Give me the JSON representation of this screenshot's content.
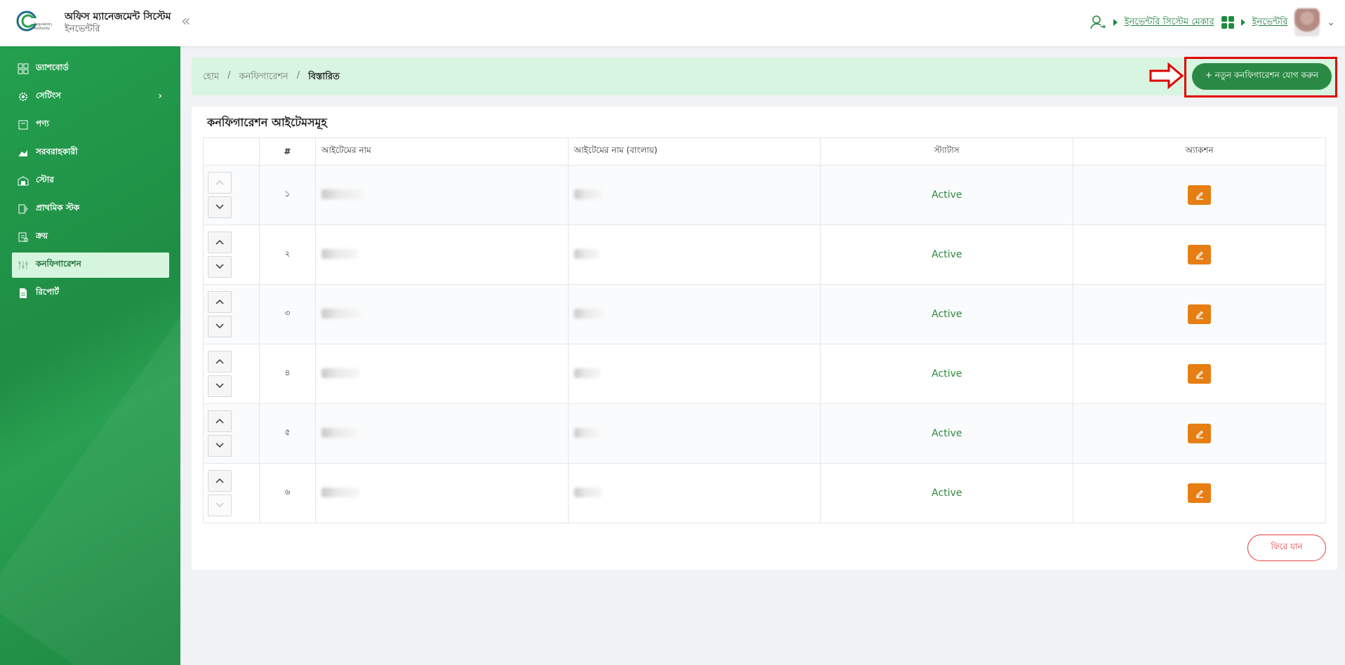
{
  "header": {
    "app_title": "অফিস ম্যানেজমেন্ট সিস্টেম",
    "app_subtitle": "ইনভেন্টরি",
    "collapse_label": "«",
    "role_link": "ইনভেন্টরি সিস্টেম মেকার",
    "module_link": "ইনভেন্টরি",
    "icons": {
      "user": "user-switch-icon",
      "apps": "grid-apps-icon",
      "chevron": "chevron-down-icon"
    }
  },
  "sidebar": {
    "items": [
      {
        "label": "ড্যাশবোর্ড",
        "icon": "dashboard-icon"
      },
      {
        "label": "সেটিংস",
        "icon": "gear-icon",
        "has_submenu": true
      },
      {
        "label": "পণ্য",
        "icon": "product-icon"
      },
      {
        "label": "সরবরাহকারী",
        "icon": "supplier-icon"
      },
      {
        "label": "স্টোর",
        "icon": "store-icon"
      },
      {
        "label": "প্রাথমিক স্টক",
        "icon": "stock-icon"
      },
      {
        "label": "ক্রয়",
        "icon": "purchase-icon"
      },
      {
        "label": "কনফিগারেশন",
        "icon": "configuration-icon",
        "active": true
      },
      {
        "label": "রিপোর্ট",
        "icon": "report-icon"
      }
    ]
  },
  "breadcrumb": {
    "items": [
      "হোম",
      "কনফিগারেশন",
      "বিস্তারিত"
    ],
    "separator": "/"
  },
  "actions": {
    "add_button": "+ নতুন কনফিগারেশন যোগ করুন",
    "back_button": "ফিরে যান"
  },
  "table": {
    "title": "কনফিগারেশন আইটেমসমূহ",
    "headers": [
      "",
      "#",
      "আইটেমের নাম",
      "আইটেমের নাম (বাংলায়)",
      "স্ট্যাটাস",
      "অ্যাকশন"
    ],
    "rows": [
      {
        "index": "১",
        "status": "Active",
        "up_disabled": true,
        "down_disabled": false
      },
      {
        "index": "২",
        "status": "Active",
        "up_disabled": false,
        "down_disabled": false
      },
      {
        "index": "৩",
        "status": "Active",
        "up_disabled": false,
        "down_disabled": false
      },
      {
        "index": "৪",
        "status": "Active",
        "up_disabled": false,
        "down_disabled": false
      },
      {
        "index": "৫",
        "status": "Active",
        "up_disabled": false,
        "down_disabled": false
      },
      {
        "index": "৬",
        "status": "Active",
        "up_disabled": false,
        "down_disabled": true
      }
    ]
  },
  "colors": {
    "primary_green": "#2a8a45",
    "sidebar_green": "#23a04e",
    "active_status": "#2d8a3e",
    "edit_orange": "#e67e13",
    "highlight_red": "#e00000"
  }
}
